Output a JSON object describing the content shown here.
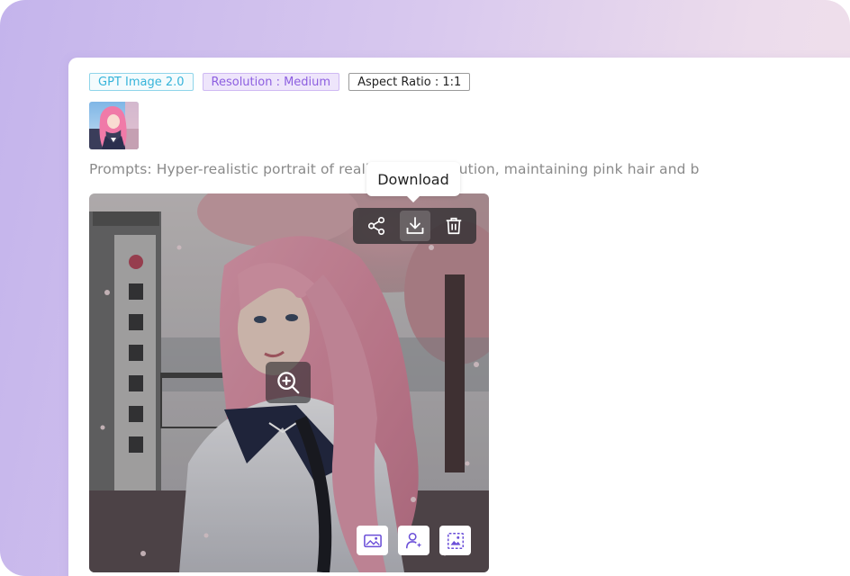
{
  "tags": {
    "model": "GPT Image 2.0",
    "resolution": "Resolution : Medium",
    "aspect_ratio": "Aspect Ratio : 1:1"
  },
  "prompt_text": "Prompts: Hyper-realistic portrait of  realistic, 8k resolution, maintaining pink hair and b",
  "image_actions": {
    "icons": [
      "share-icon",
      "download-icon",
      "delete-icon"
    ],
    "hovered": "download-icon"
  },
  "tooltip": {
    "label": "Download"
  },
  "overlay": {
    "zoom_icon": "zoom-in-icon"
  },
  "bottom_tools": [
    "image-to-image-icon",
    "face-swap-icon",
    "background-icon"
  ],
  "colors": {
    "model_tag": "#36b4da",
    "resolution_tag": "#8d5fe0",
    "tool_icon": "#6b4fd8",
    "hair": "#e9a3b8"
  }
}
